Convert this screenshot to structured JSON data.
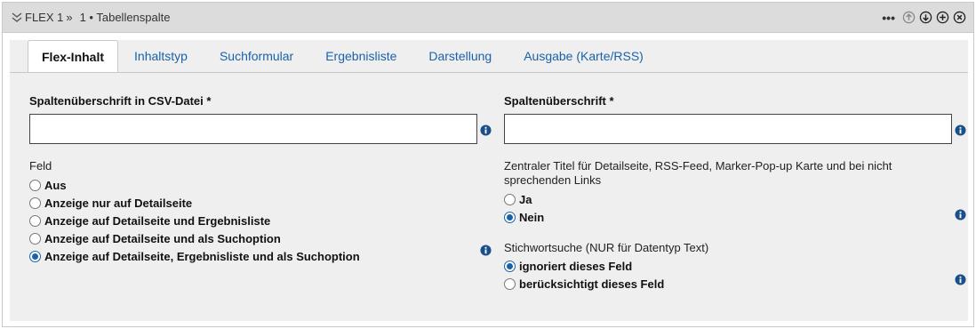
{
  "header": {
    "title": "FLEX 1",
    "separator": "»",
    "subtitle": "1 • Tabellenspalte",
    "more": "•••"
  },
  "tabs": [
    {
      "label": "Flex-Inhalt",
      "active": true
    },
    {
      "label": "Inhaltstyp",
      "active": false
    },
    {
      "label": "Suchformular",
      "active": false
    },
    {
      "label": "Ergebnisliste",
      "active": false
    },
    {
      "label": "Darstellung",
      "active": false
    },
    {
      "label": "Ausgabe (Karte/RSS)",
      "active": false
    }
  ],
  "left": {
    "csv_heading_label": "Spaltenüberschrift in CSV-Datei *",
    "csv_heading_value": "",
    "field_label": "Feld",
    "field_options": [
      {
        "label": "Aus",
        "checked": false
      },
      {
        "label": "Anzeige nur auf Detailseite",
        "checked": false
      },
      {
        "label": "Anzeige auf Detailseite und Ergebnisliste",
        "checked": false
      },
      {
        "label": "Anzeige auf Detailseite und als Suchoption",
        "checked": false
      },
      {
        "label": "Anzeige auf Detailseite, Ergebnisliste und als Suchoption",
        "checked": true
      }
    ]
  },
  "right": {
    "heading_label": "Spaltenüberschrift *",
    "heading_value": "",
    "central_title_label": "Zentraler Titel für Detailseite, RSS-Feed, Marker-Pop-up Karte und bei nicht sprechenden Links",
    "central_title_options": [
      {
        "label": "Ja",
        "checked": false
      },
      {
        "label": "Nein",
        "checked": true
      }
    ],
    "keyword_label": "Stichwortsuche (NUR für Datentyp Text)",
    "keyword_options": [
      {
        "label": "ignoriert dieses Feld",
        "checked": true
      },
      {
        "label": "berücksichtigt dieses Feld",
        "checked": false
      }
    ]
  },
  "colors": {
    "accent": "#1a62a8",
    "header_bg": "#dcdcdc",
    "content_bg": "#efefef"
  },
  "icons": [
    "chevron-double-down-icon",
    "arrow-up-circle-icon",
    "arrow-down-circle-icon",
    "plus-circle-icon",
    "close-circle-icon",
    "info-icon"
  ]
}
